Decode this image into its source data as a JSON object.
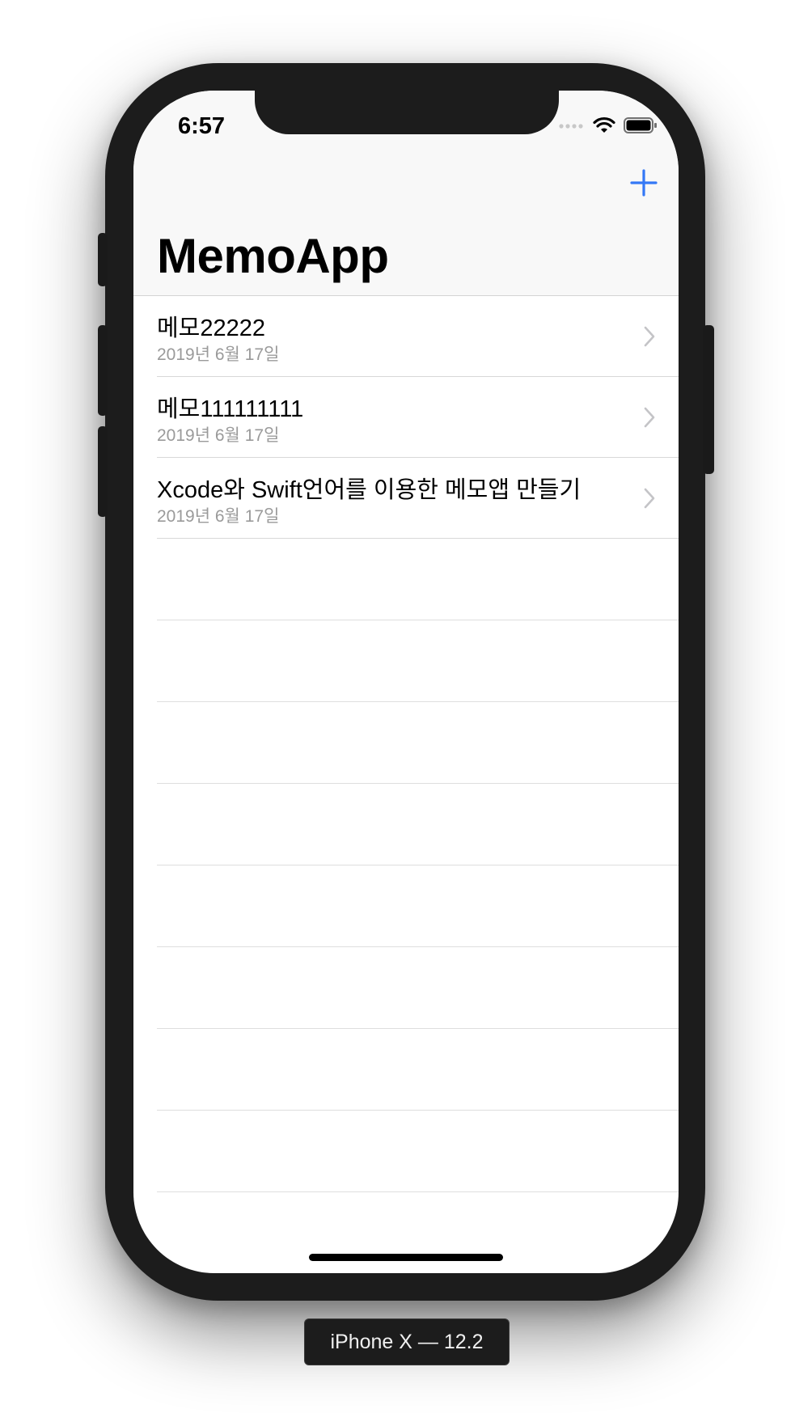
{
  "status_bar": {
    "time": "6:57"
  },
  "nav": {
    "title": "MemoApp",
    "add_icon": "plus-icon"
  },
  "memos": [
    {
      "title": "메모22222",
      "date": "2019년 6월 17일"
    },
    {
      "title": "메모111111111",
      "date": "2019년 6월 17일"
    },
    {
      "title": "Xcode와 Swift언어를 이용한 메모앱 만들기",
      "date": "2019년 6월 17일"
    }
  ],
  "simulator": {
    "label": "iPhone X — 12.2"
  },
  "colors": {
    "accent": "#3478f6",
    "subtitle": "#9a9a9a",
    "separator": "#d8d8d8",
    "device": "#1c1c1c"
  }
}
